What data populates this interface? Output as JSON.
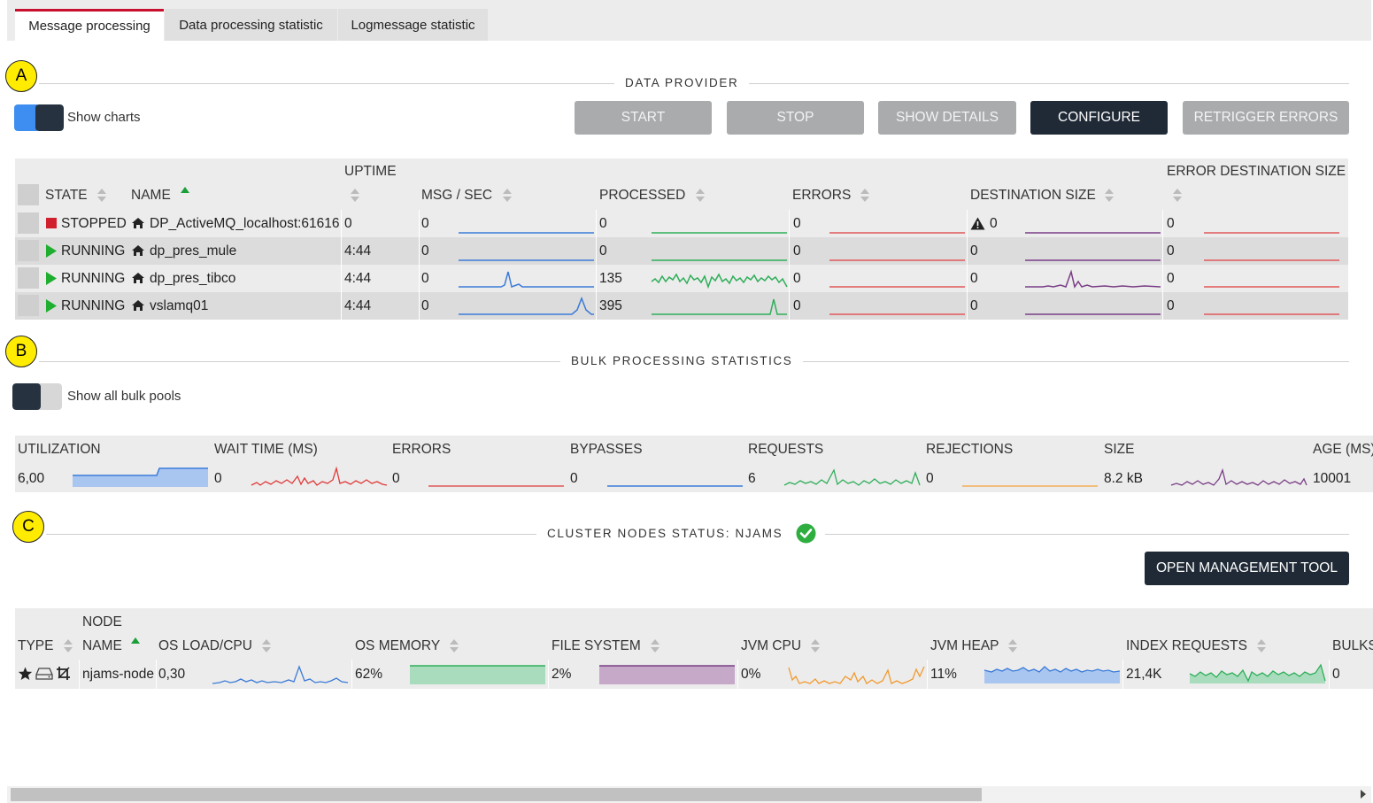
{
  "tabs": [
    {
      "label": "Message processing",
      "active": true
    },
    {
      "label": "Data processing statistic",
      "active": false
    },
    {
      "label": "Logmessage statistic",
      "active": false
    }
  ],
  "markers": {
    "a": "A",
    "b": "B",
    "c": "C"
  },
  "data_provider": {
    "title": "DATA PROVIDER",
    "show_charts_label": "Show charts",
    "show_charts_on": true,
    "buttons": {
      "start": "START",
      "stop": "STOP",
      "show_details": "SHOW DETAILS",
      "configure": "CONFIGURE",
      "retrigger_errors": "RETRIGGER ERRORS"
    },
    "columns": {
      "state": "STATE",
      "name": "NAME",
      "uptime": "UPTIME",
      "msg_sec": "MSG / SEC",
      "processed": "PROCESSED",
      "errors": "ERRORS",
      "destination_size": "DESTINATION SIZE",
      "error_destination_size": "ERROR DESTINATION SIZE"
    },
    "rows": [
      {
        "state": "STOPPED",
        "state_icon": "stop-square-icon",
        "name": "DP_ActiveMQ_localhost:61616",
        "uptime": "0",
        "msg_sec": "0",
        "processed": "0",
        "errors": "0",
        "destination_size": "0",
        "destination_warning": true,
        "error_destination_size": "0"
      },
      {
        "state": "RUNNING",
        "state_icon": "play-icon",
        "name": "dp_pres_mule",
        "uptime": "4:44",
        "msg_sec": "0",
        "processed": "0",
        "errors": "0",
        "destination_size": "0",
        "destination_warning": false,
        "error_destination_size": "0"
      },
      {
        "state": "RUNNING",
        "state_icon": "play-icon",
        "name": "dp_pres_tibco",
        "uptime": "4:44",
        "msg_sec": "0",
        "processed": "135",
        "errors": "0",
        "destination_size": "0",
        "destination_warning": false,
        "error_destination_size": "0"
      },
      {
        "state": "RUNNING",
        "state_icon": "play-icon",
        "name": "vslamq01",
        "uptime": "4:44",
        "msg_sec": "0",
        "processed": "395",
        "errors": "0",
        "destination_size": "0",
        "destination_warning": false,
        "error_destination_size": "0"
      }
    ]
  },
  "bulk": {
    "title": "BULK PROCESSING STATISTICS",
    "show_all_label": "Show all bulk pools",
    "show_all_on": false,
    "columns": {
      "utilization": "UTILIZATION",
      "wait_time": "WAIT TIME (MS)",
      "errors": "ERRORS",
      "bypasses": "BYPASSES",
      "requests": "REQUESTS",
      "rejections": "REJECTIONS",
      "size": "SIZE",
      "age": "AGE (MS)"
    },
    "row": {
      "utilization": "6,00",
      "wait_time": "0",
      "errors": "0",
      "bypasses": "0",
      "requests": "6",
      "rejections": "0",
      "size": "8.2 kB",
      "age": "10001"
    }
  },
  "cluster": {
    "title": "CLUSTER NODES STATUS: NJAMS",
    "status": "ok",
    "open_tool_label": "OPEN MANAGEMENT TOOL",
    "columns": {
      "type": "TYPE",
      "node_name_1": "NODE",
      "node_name_2": "NAME",
      "os_load": "OS LOAD/CPU",
      "os_memory": "OS MEMORY",
      "file_system": "FILE SYSTEM",
      "jvm_cpu": "JVM CPU",
      "jvm_heap": "JVM HEAP",
      "index_requests": "INDEX REQUESTS",
      "bulks": "BULKS"
    },
    "row": {
      "node_name": "njams-node",
      "os_load": "0,30",
      "os_memory": "62%",
      "os_memory_fill": 1.0,
      "file_system": "2%",
      "file_system_fill": 1.0,
      "jvm_cpu": "0%",
      "jvm_heap": "11%",
      "index_requests": "21,4K",
      "bulks": "0"
    }
  },
  "colors": {
    "blue": "#3b7bd8",
    "green": "#2eae59",
    "red": "#e0585a",
    "purple": "#7a3e86",
    "orange": "#f29a2e",
    "accent_tab": "#c8102e",
    "dark_button": "#1f2a36",
    "status_ok": "#2eae3f"
  },
  "scrollbar": {
    "thumb_fraction": 0.71
  }
}
